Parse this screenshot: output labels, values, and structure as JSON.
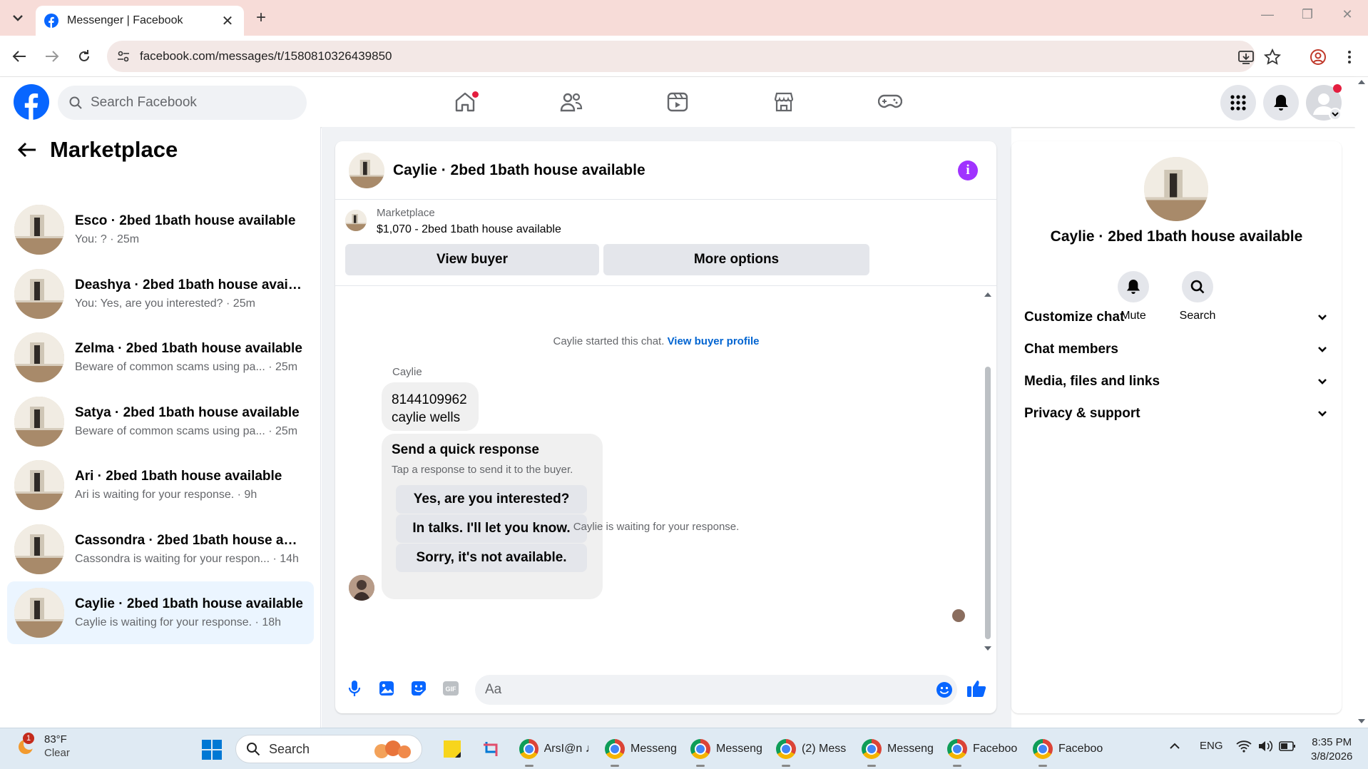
{
  "browser": {
    "tab_title": "Messenger | Facebook",
    "tab_close": "✕",
    "new_tab": "+",
    "url": "facebook.com/messages/t/1580810326439850",
    "window_controls": [
      "—",
      "❐",
      "✕"
    ]
  },
  "fb_header": {
    "search_placeholder": "Search Facebook",
    "brand_color": "#0866ff",
    "nav_icons": [
      "home-icon",
      "friends-icon",
      "video-icon",
      "marketplace-icon",
      "gaming-icon"
    ],
    "right_icons": [
      "menu-grid-icon",
      "notifications-icon",
      "account-avatar"
    ]
  },
  "sidebar": {
    "title": "Marketplace",
    "conversations": [
      {
        "name": "Esco · 2bed 1bath house available",
        "sub": "You: ? · 25m"
      },
      {
        "name": "Deashya · 2bed 1bath house availa...",
        "sub": "You: Yes, are you interested? · 25m"
      },
      {
        "name": "Zelma · 2bed 1bath house available",
        "sub": "Beware of common scams using pa... · 25m"
      },
      {
        "name": "Satya · 2bed 1bath house available",
        "sub": "Beware of common scams using pa... · 25m"
      },
      {
        "name": "Ari · 2bed 1bath house available",
        "sub": "Ari is waiting for your response. · 9h"
      },
      {
        "name": "Cassondra · 2bed 1bath house avai...",
        "sub": "Cassondra is waiting for your respon... · 14h"
      },
      {
        "name": "Caylie · 2bed 1bath house available",
        "sub": "Caylie is waiting for your response. · 18h"
      }
    ]
  },
  "chat": {
    "title": "Caylie · 2bed 1bath house available",
    "marketplace_label": "Marketplace",
    "listing": "$1,070 - 2bed 1bath house available",
    "view_buyer": "View buyer",
    "more_options": "More options",
    "started_text": "Caylie started this chat.",
    "view_buyer_profile": "View buyer profile",
    "sender_name": "Caylie",
    "message_line1": "8144109962",
    "message_line2": "caylie wells",
    "quick_title": "Send a quick response",
    "quick_sub": "Tap a response to send it to the buyer.",
    "quick_replies": [
      "Yes, are you interested?",
      "In talks. I'll let you know.",
      "Sorry, it's not available."
    ],
    "waiting_text": "Caylie is waiting for your response.",
    "input_placeholder": "Aa"
  },
  "details": {
    "title": "Caylie · 2bed 1bath house available",
    "mute": "Mute",
    "search": "Search",
    "sections": [
      "Customize chat",
      "Chat members",
      "Media, files and links",
      "Privacy & support"
    ]
  },
  "taskbar": {
    "temp": "83°F",
    "condition": "Clear",
    "weather_badge": "1",
    "search": "Search",
    "apps": [
      "ArsI@n ♩",
      "Messeng",
      "Messeng",
      "(2) Mess",
      "Messeng",
      "Faceboo",
      "Faceboo"
    ],
    "lang": "ENG",
    "time": "8:35 PM",
    "date": "3/8/2026"
  }
}
